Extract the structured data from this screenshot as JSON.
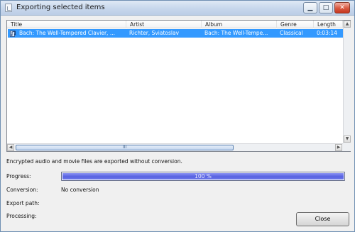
{
  "window": {
    "title": "Exporting selected items"
  },
  "list": {
    "columns": [
      "Title",
      "Artist",
      "Album",
      "Genre",
      "Length"
    ],
    "rows": [
      {
        "title": "Bach: The Well-Tempered Clavier, ...",
        "artist": "Richter, Sviatoslav",
        "album": "Bach: The Well-Tempe...",
        "genre": "Classical",
        "length": "0:03:14",
        "icon": "music-track-icon"
      }
    ],
    "scroll_grip": "III"
  },
  "info_text": "Encrypted audio and movie files are exported without conversion.",
  "status": {
    "progress_label": "Progress:",
    "progress_value": 100,
    "progress_text": "100 %",
    "conversion_label": "Conversion:",
    "conversion_value": "No conversion",
    "export_path_label": "Export path:",
    "processing_label": "Processing:"
  },
  "buttons": {
    "close_label": "Close"
  },
  "colors": {
    "selection": "#3399ff",
    "progress": "#5762e0"
  }
}
